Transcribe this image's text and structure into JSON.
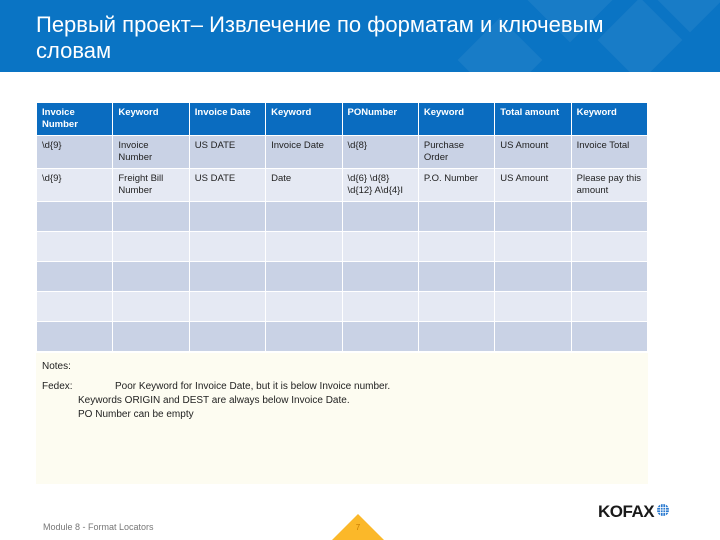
{
  "header": {
    "title": "Первый проект– Извлечение по форматам и ключевым словам",
    "background_color": "#0a74c4"
  },
  "table": {
    "columns": [
      "Invoice Number",
      "Keyword",
      "Invoice Date",
      "Keyword",
      "PONumber",
      "Keyword",
      "Total amount",
      "Keyword"
    ],
    "rows": [
      [
        "\\d{9}",
        "Invoice Number",
        "US DATE",
        "Invoice Date",
        "\\d{8}",
        "Purchase Order",
        "US Amount",
        "Invoice Total"
      ],
      [
        "\\d{9}",
        "Freight Bill Number",
        "US DATE",
        "Date",
        "\\d{6} \\d{8} \\d{12} A\\d{4}I",
        "P.O. Number",
        "US Amount",
        "Please pay this amount"
      ],
      [
        "",
        "",
        "",
        "",
        "",
        "",
        "",
        ""
      ],
      [
        "",
        "",
        "",
        "",
        "",
        "",
        "",
        ""
      ],
      [
        "",
        "",
        "",
        "",
        "",
        "",
        "",
        ""
      ],
      [
        "",
        "",
        "",
        "",
        "",
        "",
        "",
        ""
      ],
      [
        "",
        "",
        "",
        "",
        "",
        "",
        "",
        ""
      ]
    ],
    "header_color": "#0a6cc0",
    "row_dark_color": "#c9d2e5",
    "row_light_color": "#e5e9f3"
  },
  "notes": {
    "title": "Notes:",
    "label": "Fedex:",
    "lines": [
      "Poor Keyword for Invoice Date, but it is below Invoice number.",
      "Keywords ORIGIN and DEST are always below Invoice Date.",
      "PO Number can be empty"
    ]
  },
  "footer": {
    "module_text": "Module 8 - Format Locators",
    "page_number": "7",
    "logo_text": "KOFAX",
    "accent_color": "#fbb829"
  }
}
